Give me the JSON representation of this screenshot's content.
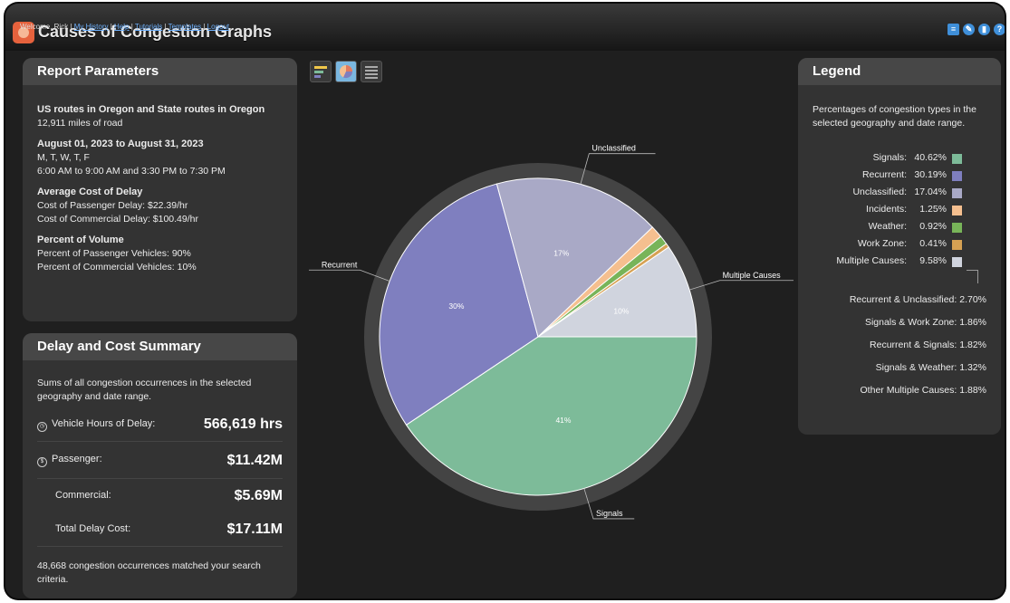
{
  "header": {
    "title": "Causes of Congestion Graphs",
    "welcome": "Welcome, Rick |",
    "links": [
      "My History",
      "Help",
      "Tutorials",
      "Templates",
      "Logout"
    ]
  },
  "params": {
    "title": "Report Parameters",
    "routes": "US routes in Oregon and State routes in Oregon",
    "miles": "12,911 miles of road",
    "dates": "August 01, 2023 to August 31, 2023",
    "days": "M, T, W, T, F",
    "times": "6:00 AM to 9:00 AM and 3:30 PM to 7:30 PM",
    "cost_head": "Average Cost of Delay",
    "cost_pass": "Cost of Passenger Delay: $22.39/hr",
    "cost_comm": "Cost of Commercial Delay: $100.49/hr",
    "vol_head": "Percent of Volume",
    "vol_pass": "Percent of Passenger Vehicles: 90%",
    "vol_comm": "Percent of Commercial Vehicles: 10%"
  },
  "summary": {
    "title": "Delay and Cost Summary",
    "desc": "Sums of all congestion occurrences in the selected geography and date range.",
    "rows": [
      {
        "label": "Vehicle Hours of Delay:",
        "value": "566,619 hrs"
      },
      {
        "label": "Passenger:",
        "value": "$11.42M"
      },
      {
        "label": "Commercial:",
        "value": "$5.69M"
      },
      {
        "label": "Total Delay Cost:",
        "value": "$17.11M"
      }
    ],
    "footer": "48,668 congestion occurrences matched your search criteria."
  },
  "legend": {
    "title": "Legend",
    "desc": "Percentages of congestion types in the selected geography and date range.",
    "items": [
      {
        "name": "Signals:",
        "pct": "40.62%",
        "color": "#7dbb99"
      },
      {
        "name": "Recurrent:",
        "pct": "30.19%",
        "color": "#7f7fbf"
      },
      {
        "name": "Unclassified:",
        "pct": "17.04%",
        "color": "#a9a9c6"
      },
      {
        "name": "Incidents:",
        "pct": "1.25%",
        "color": "#f5bf8f"
      },
      {
        "name": "Weather:",
        "pct": "0.92%",
        "color": "#78b459"
      },
      {
        "name": "Work Zone:",
        "pct": "0.41%",
        "color": "#d6a153"
      },
      {
        "name": "Multiple Causes:",
        "pct": "9.58%",
        "color": "#d0d4de"
      }
    ],
    "multiple": [
      "Recurrent & Unclassified: 2.70%",
      "Signals & Work Zone: 1.86%",
      "Recurrent & Signals: 1.82%",
      "Signals & Weather: 1.32%",
      "Other Multiple Causes: 1.88%"
    ]
  },
  "chart_data": {
    "type": "pie",
    "slices": [
      {
        "name": "Signals",
        "value": 40.62,
        "color": "#7dbb99",
        "label": "41%",
        "callout": "Signals"
      },
      {
        "name": "Recurrent",
        "value": 30.19,
        "color": "#7f7fbf",
        "label": "30%",
        "callout": "Recurrent"
      },
      {
        "name": "Unclassified",
        "value": 17.04,
        "color": "#a9a9c6",
        "label": "17%",
        "callout": "Unclassified"
      },
      {
        "name": "Incidents",
        "value": 1.25,
        "color": "#f5bf8f",
        "label": "",
        "callout": ""
      },
      {
        "name": "Weather",
        "value": 0.92,
        "color": "#78b459",
        "label": "",
        "callout": ""
      },
      {
        "name": "Work Zone",
        "value": 0.41,
        "color": "#d6a153",
        "label": "",
        "callout": ""
      },
      {
        "name": "Multiple Causes",
        "value": 9.58,
        "color": "#d0d4de",
        "label": "10%",
        "callout": "Multiple Causes"
      }
    ]
  }
}
